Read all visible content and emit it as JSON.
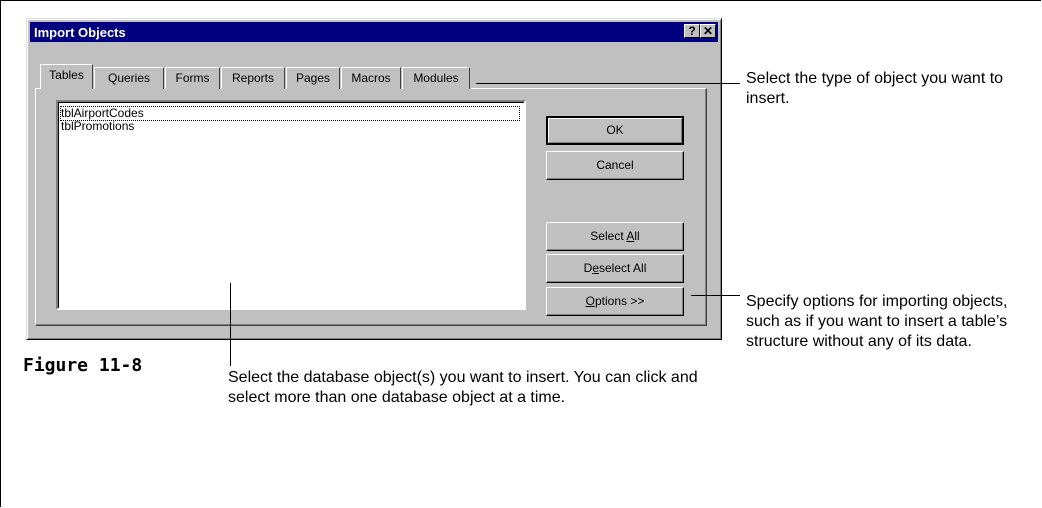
{
  "dialog": {
    "title": "Import Objects",
    "help_glyph": "?",
    "close_glyph": "✕",
    "tabs": [
      "Tables",
      "Queries",
      "Forms",
      "Reports",
      "Pages",
      "Macros",
      "Modules"
    ],
    "active_tab": "Tables",
    "list_items": [
      "tblAirportCodes",
      "tblPromotions"
    ],
    "buttons": {
      "ok": "OK",
      "cancel": "Cancel",
      "select_all_pre": "Select ",
      "select_all_u": "A",
      "select_all_post": "ll",
      "deselect_all_pre": "D",
      "deselect_all_u": "e",
      "deselect_all_post": "select All",
      "options_u": "O",
      "options_post": "ptions >>"
    }
  },
  "annotations": {
    "tabs_note": "Select the type of object you want to insert.",
    "options_note": "Specify options for importing objects, such as if you want to insert a table’s structure without any of its data.",
    "list_note": "Select the database object(s) you want to insert. You can click and select more than one database object at a time."
  },
  "caption": "Figure 11-8"
}
